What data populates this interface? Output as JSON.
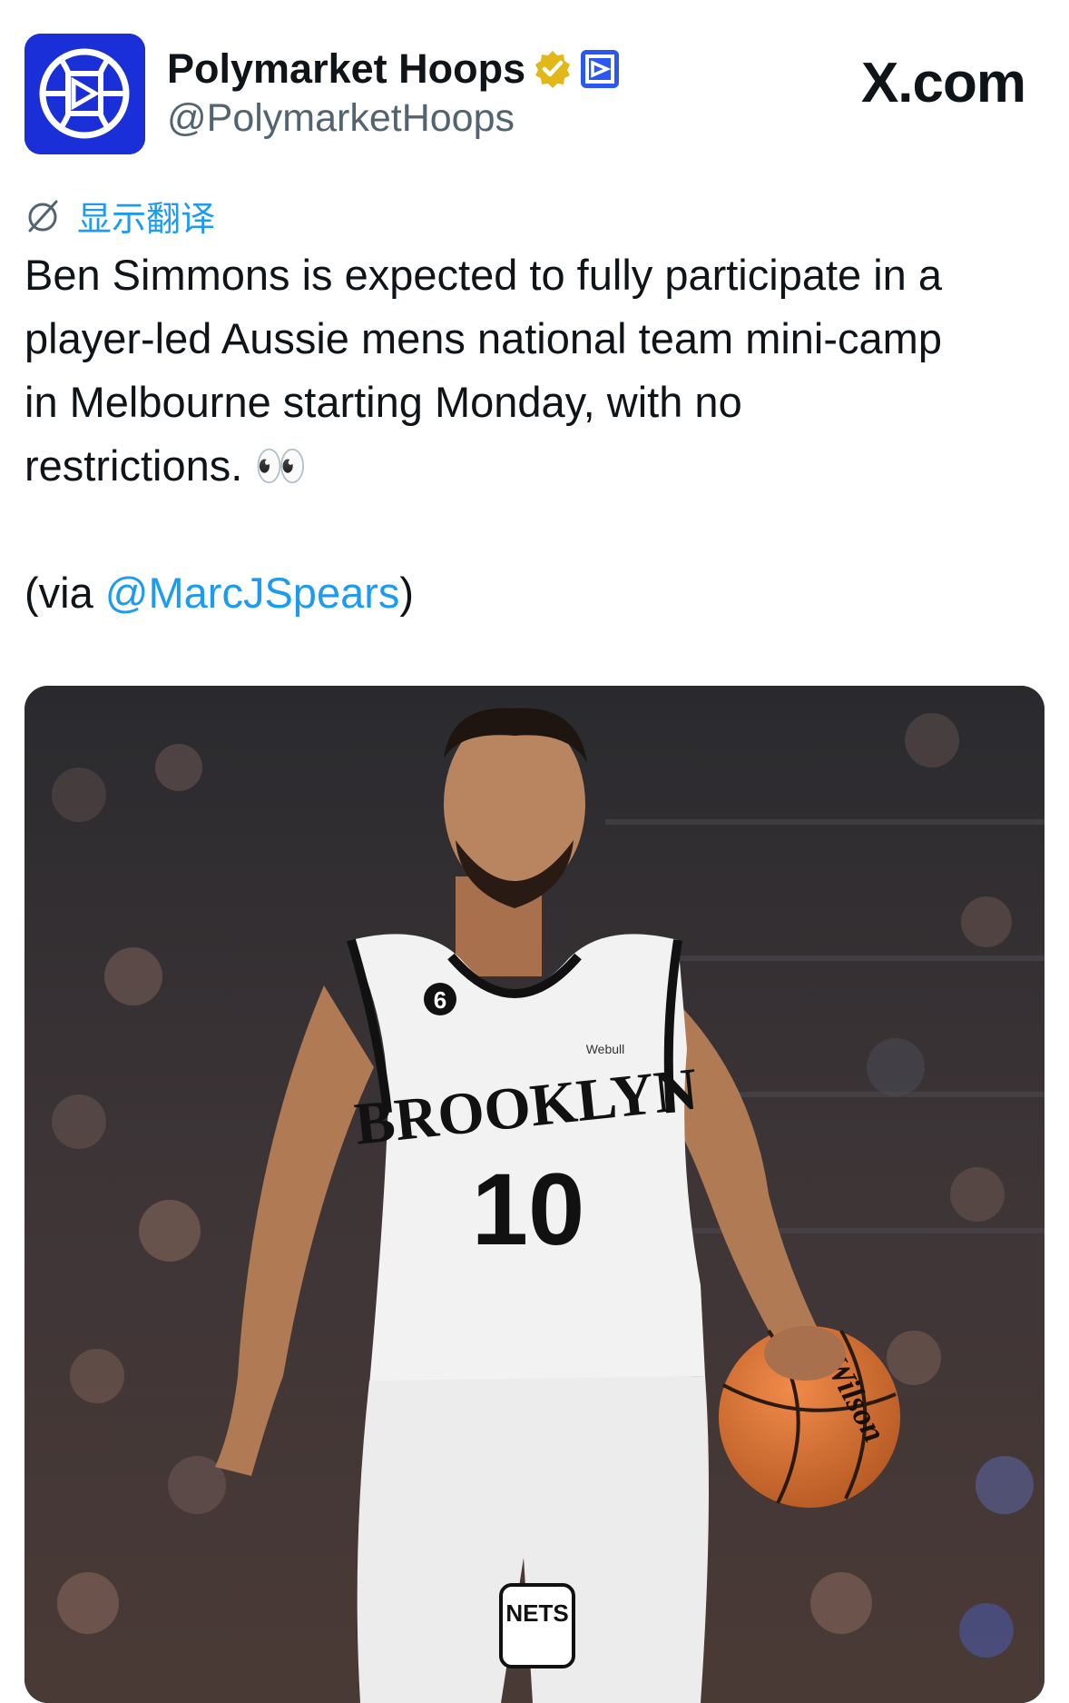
{
  "header": {
    "display_name": "Polymarket Hoops",
    "handle": "@PolymarketHoops",
    "brand": "X.com",
    "badges": [
      "verified-gold-icon",
      "polymarket-affiliate-icon"
    ]
  },
  "translate": {
    "icon": "globe-slash-icon",
    "label": "显示翻译"
  },
  "tweet": {
    "lines": [
      "Ben Simmons is expected to fully participate in a",
      "player-led Aussie mens national team mini-camp",
      "in Melbourne starting Monday, with no",
      "restrictions. 👀"
    ],
    "via_prefix": "(via ",
    "via_mention": "@MarcJSpears",
    "via_suffix": ")"
  },
  "media": {
    "jersey_text": "BROOKLYN",
    "jersey_number": "10",
    "patch_number": "6",
    "sponsor": "Webull",
    "ball_brand": "Wilson",
    "shorts_logo": "NETS",
    "colors": {
      "jersey": "#f2f2f2",
      "trim": "#111111",
      "ball": "#d9753a",
      "crowd": "#3b3437"
    }
  }
}
